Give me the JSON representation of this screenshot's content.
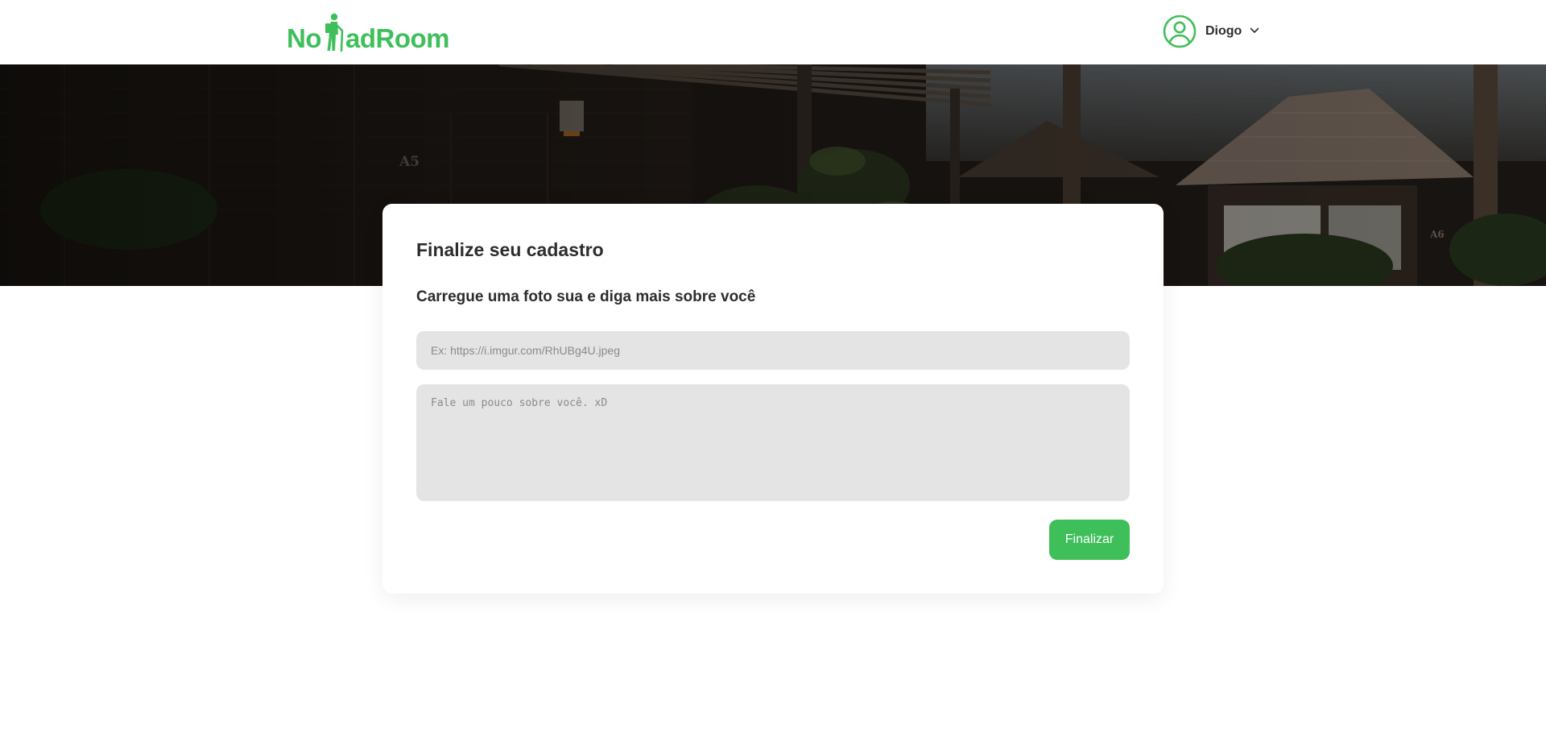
{
  "brand": {
    "logo_left": "No",
    "logo_right": "adRoom",
    "color": "#3fbf5a"
  },
  "header": {
    "user_name": "Diogo",
    "avatar_icon": "user-circle-icon",
    "menu_icon": "chevron-down-icon"
  },
  "hero": {
    "image": "tropical-wooden-lodge-photo",
    "unit_labels": [
      "A5",
      "A6"
    ]
  },
  "form": {
    "title": "Finalize seu cadastro",
    "subtitle": "Carregue uma foto sua e diga mais sobre você",
    "photo_url": {
      "value": "",
      "placeholder": "Ex: https://i.imgur.com/RhUBg4U.jpeg"
    },
    "about": {
      "value": "",
      "placeholder": "Fale um pouco sobre você. xD"
    },
    "submit_label": "Finalizar",
    "accent": "#3fbf5a"
  }
}
